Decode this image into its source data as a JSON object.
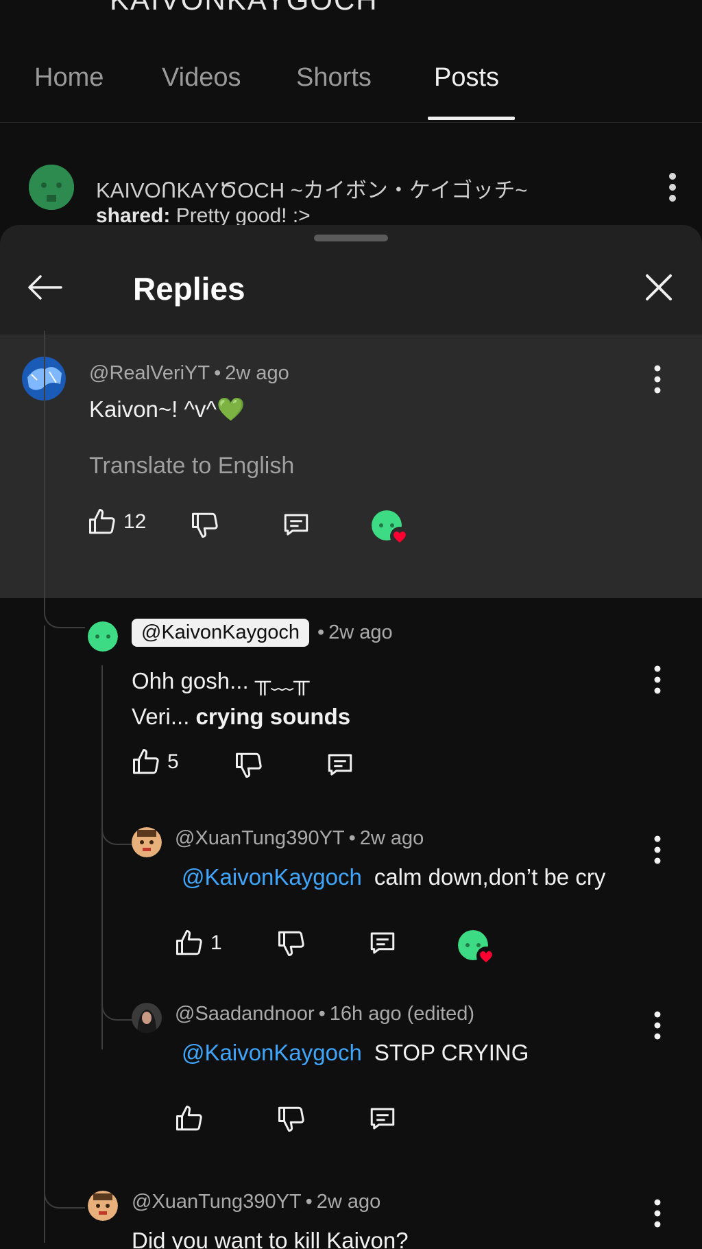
{
  "channel": {
    "title_cut": "KAIVONKAYGOCH"
  },
  "tabs": [
    {
      "label": "Home"
    },
    {
      "label": "Videos"
    },
    {
      "label": "Shorts"
    },
    {
      "label": "Posts"
    }
  ],
  "post": {
    "channel": "KΑIVOՈKΑYԾOCH ~カイボン・ケイゴッチ~",
    "shared_label": "shared:",
    "shared_text": "Pretty good! :>"
  },
  "sheet": {
    "title": "Replies"
  },
  "parent": {
    "handle": "@RealVeriYT",
    "time": "2w ago",
    "text": "Kaivon~! ^v^💚",
    "translate": "Translate to English",
    "likes": "12"
  },
  "replies": [
    {
      "handle": "@KaivonKaygoch",
      "time": "2w ago",
      "line1": "Ohh gosh... ╥﹏╥",
      "line2_plain": "Veri... ",
      "line2_bold": "crying sounds",
      "likes": "5"
    },
    {
      "handle": "@XuanTung390YT",
      "time": "2w ago",
      "mention": "@KaivonKaygoch",
      "text": "calm down,don’t be cry",
      "likes": "1"
    },
    {
      "handle": "@Saadandnoor",
      "time": "16h ago (edited)",
      "mention": "@KaivonKaygoch",
      "text": "STOP CRYING"
    },
    {
      "handle": "@XuanTung390YT",
      "time": "2w ago",
      "text": "Did you want to kill Kaivon?"
    }
  ],
  "sep": "•",
  "colors": {
    "background": "#0f0f0f",
    "sheet": "#212121",
    "highlight": "#2b2b2b",
    "mention": "#3ea6ff",
    "heart": "#ff0033",
    "kaivon_avatar": "#3ddc84"
  }
}
